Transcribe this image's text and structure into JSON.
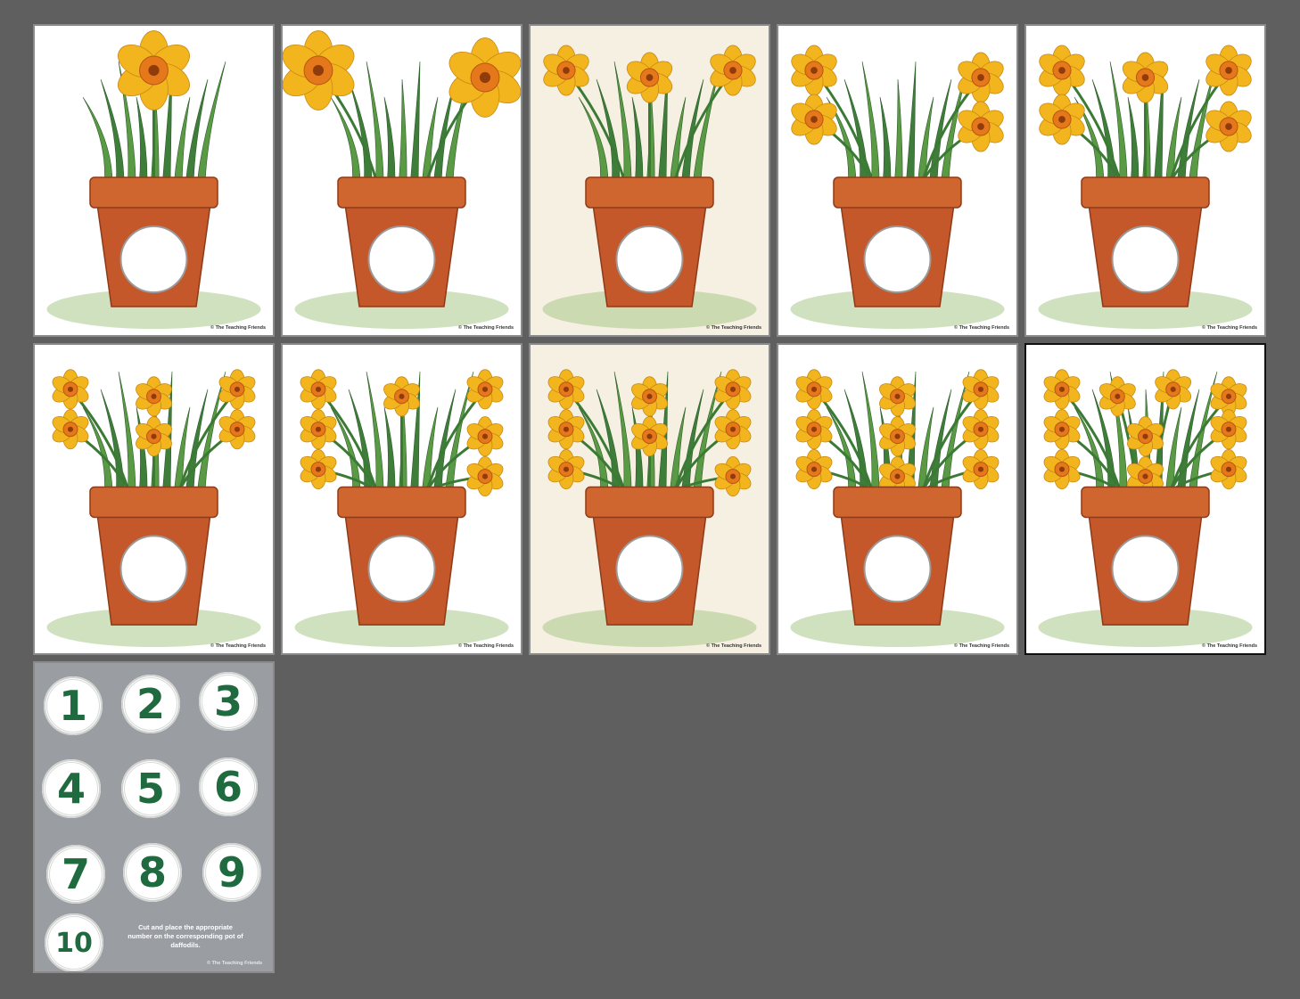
{
  "cards": [
    {
      "credit": "© The Teaching Friends",
      "flowers": 1
    },
    {
      "credit": "© The Teaching Friends",
      "flowers": 2
    },
    {
      "credit": "© The Teaching Friends",
      "flowers": 3
    },
    {
      "credit": "© The Teaching Friends",
      "flowers": 4
    },
    {
      "credit": "© The Teaching Friends",
      "flowers": 5
    },
    {
      "credit": "© The Teaching Friends",
      "flowers": 6
    },
    {
      "credit": "© The Teaching Friends",
      "flowers": 7
    },
    {
      "credit": "© The Teaching Friends",
      "flowers": 8
    },
    {
      "credit": "© The Teaching Friends",
      "flowers": 9
    },
    {
      "credit": "© The Teaching Friends",
      "flowers": 10
    }
  ],
  "number_sheet": {
    "numbers": [
      "1",
      "2",
      "3",
      "4",
      "5",
      "6",
      "7",
      "8",
      "9",
      "10"
    ],
    "instruction": "Cut and place the appropriate number on the corresponding pot of daffodils.",
    "credit": "© The Teaching Friends"
  },
  "colors": {
    "background": "#5f5f5f",
    "pot": "#c4582a",
    "petal": "#f2b51e",
    "corona": "#e5781b",
    "leaf": "#3f7d3a",
    "number_text": "#1f6b3f"
  }
}
